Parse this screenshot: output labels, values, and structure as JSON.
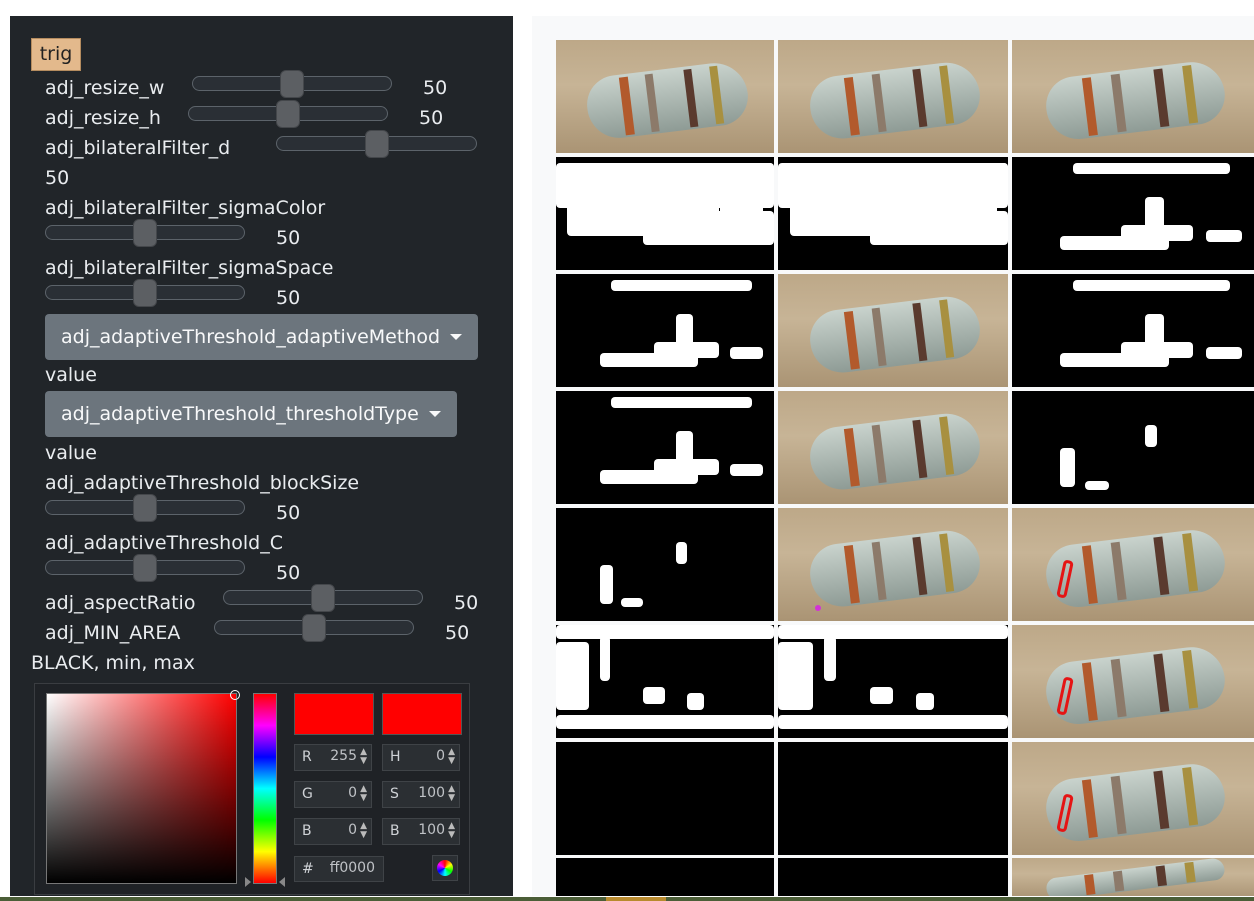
{
  "controls": {
    "trig_label": "trig",
    "sliders": [
      {
        "label": "adj_resize_w",
        "value": "50",
        "level": 0.5
      },
      {
        "label": "adj_resize_h",
        "value": "50",
        "level": 0.5
      },
      {
        "label": "adj_bilateralFilter_d",
        "value": "50",
        "level": 0.5
      },
      {
        "label": "adj_bilateralFilter_sigmaColor",
        "value": "50",
        "level": 0.5
      },
      {
        "label": "adj_bilateralFilter_sigmaSpace",
        "value": "50",
        "level": 0.5
      },
      {
        "label": "adj_adaptiveThreshold_blockSize",
        "value": "50",
        "level": 0.5
      },
      {
        "label": "adj_adaptiveThreshold_C",
        "value": "50",
        "level": 0.5
      },
      {
        "label": "adj_aspectRatio",
        "value": "50",
        "level": 0.5
      },
      {
        "label": "adj_MIN_AREA",
        "value": "50",
        "level": 0.5
      }
    ],
    "dropdowns": [
      {
        "label": "adj_adaptiveThreshold_adaptiveMethod",
        "value_label": "value"
      },
      {
        "label": "adj_adaptiveThreshold_thresholdType",
        "value_label": "value"
      }
    ],
    "color_section_label": "BLACK, min, max"
  },
  "color_picker": {
    "selected_hex": "ff0000",
    "selected_color": "#ff0000",
    "hash": "#",
    "rgb": [
      {
        "label": "R",
        "value": "255"
      },
      {
        "label": "G",
        "value": "0"
      },
      {
        "label": "B",
        "value": "0"
      }
    ],
    "hsb": [
      {
        "label": "H",
        "value": "0"
      },
      {
        "label": "S",
        "value": "100"
      },
      {
        "label": "B",
        "value": "100"
      }
    ]
  },
  "theme": {
    "panel_bg": "#212529",
    "trig_bg": "#e3b98c",
    "dropdown_bg": "#6c757d",
    "contour_color": "#e51414"
  }
}
